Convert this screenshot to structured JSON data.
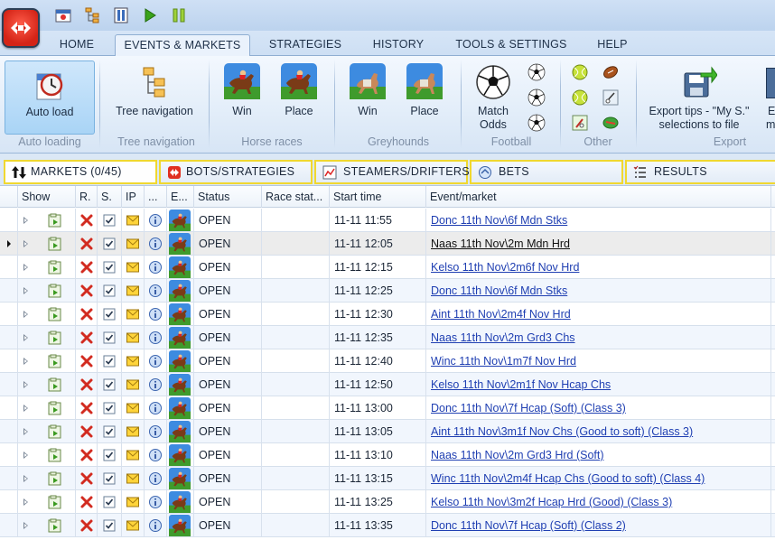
{
  "menu_tabs": [
    "HOME",
    "EVENTS & MARKETS",
    "STRATEGIES",
    "HISTORY",
    "TOOLS & SETTINGS",
    "HELP"
  ],
  "active_tab": "EVENTS & MARKETS",
  "ribbon": {
    "auto_load": "Auto load",
    "tree_navigation": "Tree navigation",
    "horse_win": "Win",
    "horse_place": "Place",
    "grey_win": "Win",
    "grey_place": "Place",
    "match_odds_1": "Match",
    "match_odds_2": "Odds",
    "export_1": "Export tips - \"My S.\"",
    "export_2": "selections to file",
    "cut_1": "E",
    "cut_2": "m",
    "groups": {
      "auto_loading": "Auto loading",
      "tree_navigation": "Tree navigation",
      "horse_races": "Horse races",
      "greyhounds": "Greyhounds",
      "football": "Football",
      "other": "Other",
      "export": "Export"
    }
  },
  "panel_tabs": {
    "markets": "MARKETS (0/45)",
    "bots": "BOTS/STRATEGIES",
    "steamers": "STEAMERS/DRIFTERS",
    "bets": "BETS",
    "results": "RESULTS"
  },
  "columns": {
    "show": "Show",
    "r": "R.",
    "s": "S.",
    "ip": "IP",
    "dots": "...",
    "e": "E...",
    "status": "Status",
    "race_status": "Race stat...",
    "start_time": "Start time",
    "event_market": "Event/market"
  },
  "rows": [
    {
      "status": "OPEN",
      "start": "11-11 11:55",
      "market": "Donc 11th Nov\\6f Mdn Stks"
    },
    {
      "status": "OPEN",
      "start": "11-11 12:05",
      "market": "Naas 11th Nov\\2m Mdn Hrd"
    },
    {
      "status": "OPEN",
      "start": "11-11 12:15",
      "market": "Kelso  11th Nov\\2m6f Nov Hrd"
    },
    {
      "status": "OPEN",
      "start": "11-11 12:25",
      "market": "Donc 11th Nov\\6f Mdn Stks"
    },
    {
      "status": "OPEN",
      "start": "11-11 12:30",
      "market": "Aint  11th Nov\\2m4f Nov Hrd"
    },
    {
      "status": "OPEN",
      "start": "11-11 12:35",
      "market": "Naas 11th Nov\\2m Grd3 Chs"
    },
    {
      "status": "OPEN",
      "start": "11-11 12:40",
      "market": "Winc 11th Nov\\1m7f Nov Hrd"
    },
    {
      "status": "OPEN",
      "start": "11-11 12:50",
      "market": "Kelso  11th Nov\\2m1f Nov Hcap Chs"
    },
    {
      "status": "OPEN",
      "start": "11-11 13:00",
      "market": "Donc 11th Nov\\7f Hcap (Soft) (Class 3)"
    },
    {
      "status": "OPEN",
      "start": "11-11 13:05",
      "market": "Aint  11th Nov\\3m1f Nov Chs (Good to soft) (Class 3)"
    },
    {
      "status": "OPEN",
      "start": "11-11 13:10",
      "market": "Naas 11th Nov\\2m Grd3 Hrd (Soft)"
    },
    {
      "status": "OPEN",
      "start": "11-11 13:15",
      "market": "Winc 11th Nov\\2m4f Hcap Chs (Good to soft) (Class 4)"
    },
    {
      "status": "OPEN",
      "start": "11-11 13:25",
      "market": "Kelso  11th Nov\\3m2f Hcap Hrd (Good) (Class 3)"
    },
    {
      "status": "OPEN",
      "start": "11-11 13:35",
      "market": "Donc 11th Nov\\7f Hcap (Soft) (Class 2)"
    }
  ]
}
